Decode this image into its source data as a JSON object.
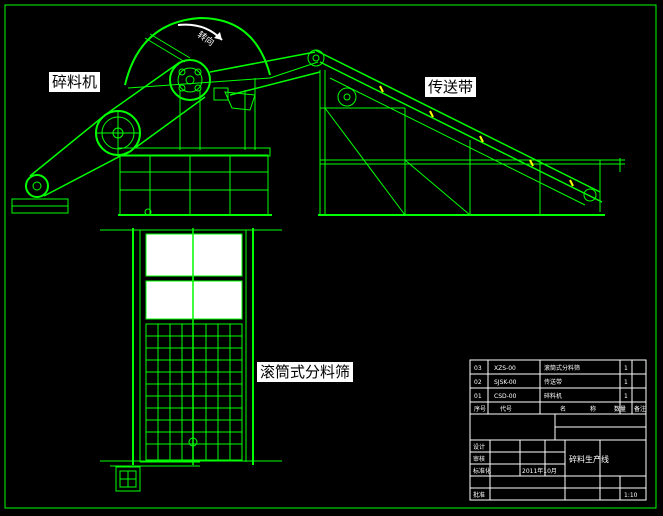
{
  "labels": {
    "crusher": "碎料机",
    "conveyor": "传送带",
    "drum_screen": "滚筒式分料筛"
  },
  "rotation_mark": "转向",
  "title_block": {
    "parts_list": [
      {
        "no": "03",
        "code": "XZS-00",
        "name": "滚筒式分料筛",
        "qty": "1"
      },
      {
        "no": "02",
        "code": "SJSK-00",
        "name": "传送带",
        "qty": "1"
      },
      {
        "no": "01",
        "code": "CSD-00",
        "name": "碎料机",
        "qty": "1"
      }
    ],
    "header": [
      "序号",
      "代号",
      "名",
      "称",
      "数量",
      "备注"
    ],
    "drawing_title": "碎料生产线",
    "date": "2011年10月",
    "scale": "1:10",
    "rows": [
      "设计",
      "审核",
      "标准化",
      "批准"
    ]
  },
  "colors": {
    "background": "#000000",
    "frame": "#00ff00",
    "structure": "#00ff00",
    "mesh_fill": "#ffffff",
    "accent": "#ffff00"
  }
}
